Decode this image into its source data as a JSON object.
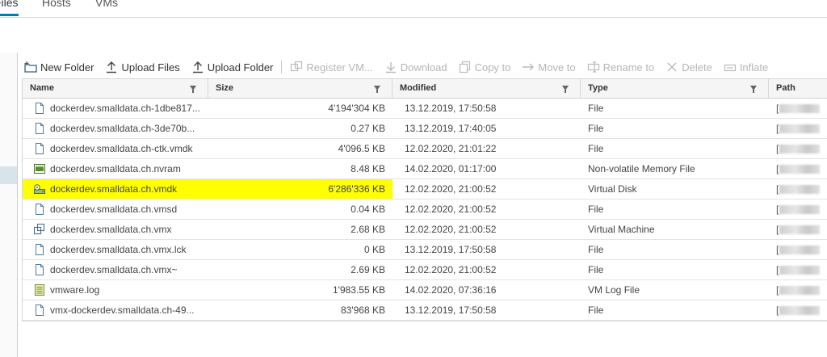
{
  "tabs": [
    {
      "label": "Files",
      "active": true
    },
    {
      "label": "Hosts",
      "active": false
    },
    {
      "label": "VMs",
      "active": false
    }
  ],
  "toolbar": [
    {
      "label": "New Folder",
      "icon": "new-folder-icon",
      "enabled": true
    },
    {
      "label": "Upload Files",
      "icon": "upload-icon",
      "enabled": true
    },
    {
      "label": "Upload Folder",
      "icon": "upload-icon",
      "enabled": true
    },
    {
      "label": "Register VM...",
      "icon": "register-vm-icon",
      "enabled": false
    },
    {
      "label": "Download",
      "icon": "download-icon",
      "enabled": false
    },
    {
      "label": "Copy to",
      "icon": "copy-icon",
      "enabled": false
    },
    {
      "label": "Move to",
      "icon": "move-arrow-icon",
      "enabled": false
    },
    {
      "label": "Rename to",
      "icon": "rename-icon",
      "enabled": false
    },
    {
      "label": "Delete",
      "icon": "delete-x-icon",
      "enabled": false
    },
    {
      "label": "Inflate",
      "icon": "inflate-icon",
      "enabled": false
    }
  ],
  "columns": {
    "name": "Name",
    "size": "Size",
    "modified": "Modified",
    "type": "Type",
    "path": "Path"
  },
  "files": [
    {
      "name": "dockerdev.smalldata.ch-1dbe817...",
      "size": "4'194'304 KB",
      "modified": "13.12.2019, 17:50:58",
      "type": "File",
      "icon": "file-icon",
      "path": "[",
      "highlighted": false
    },
    {
      "name": "dockerdev.smalldata.ch-3de70b...",
      "size": "0.27 KB",
      "modified": "13.12.2019, 17:40:05",
      "type": "File",
      "icon": "file-icon",
      "path": "[",
      "highlighted": false
    },
    {
      "name": "dockerdev.smalldata.ch-ctk.vmdk",
      "size": "4'096.5 KB",
      "modified": "12.02.2020, 21:01:22",
      "type": "File",
      "icon": "file-icon",
      "path": "[",
      "highlighted": false
    },
    {
      "name": "dockerdev.smalldata.ch.nvram",
      "size": "8.48 KB",
      "modified": "14.02.2020, 01:17:00",
      "type": "Non-volatile Memory File",
      "icon": "nvram-icon",
      "path": "[",
      "highlighted": false
    },
    {
      "name": "dockerdev.smalldata.ch.vmdk",
      "size": "6'286'336 KB",
      "modified": "12.02.2020, 21:00:52",
      "type": "Virtual Disk",
      "icon": "virtual-disk-icon",
      "path": "[",
      "highlighted": true
    },
    {
      "name": "dockerdev.smalldata.ch.vmsd",
      "size": "0.04 KB",
      "modified": "12.02.2020, 21:00:52",
      "type": "File",
      "icon": "file-icon",
      "path": "[",
      "highlighted": false
    },
    {
      "name": "dockerdev.smalldata.ch.vmx",
      "size": "2.68 KB",
      "modified": "12.02.2020, 21:00:52",
      "type": "Virtual Machine",
      "icon": "virtual-machine-icon",
      "path": "[",
      "highlighted": false
    },
    {
      "name": "dockerdev.smalldata.ch.vmx.lck",
      "size": "0 KB",
      "modified": "13.12.2019, 17:50:58",
      "type": "File",
      "icon": "file-icon",
      "path": "[",
      "highlighted": false
    },
    {
      "name": "dockerdev.smalldata.ch.vmx~",
      "size": "2.69 KB",
      "modified": "12.02.2020, 21:00:52",
      "type": "File",
      "icon": "file-icon",
      "path": "[",
      "highlighted": false
    },
    {
      "name": "vmware.log",
      "size": "1'983.55 KB",
      "modified": "14.02.2020, 07:36:16",
      "type": "VM Log File",
      "icon": "log-file-icon",
      "path": "[",
      "highlighted": false
    },
    {
      "name": "vmx-dockerdev.smalldata.ch-49...",
      "size": "83'968 KB",
      "modified": "13.12.2019, 17:50:58",
      "type": "File",
      "icon": "file-icon",
      "path": "[",
      "highlighted": false
    }
  ],
  "colors": {
    "accent": "#0079b8",
    "highlight": "#ffff00",
    "header_bg": "#f5f5f5"
  }
}
